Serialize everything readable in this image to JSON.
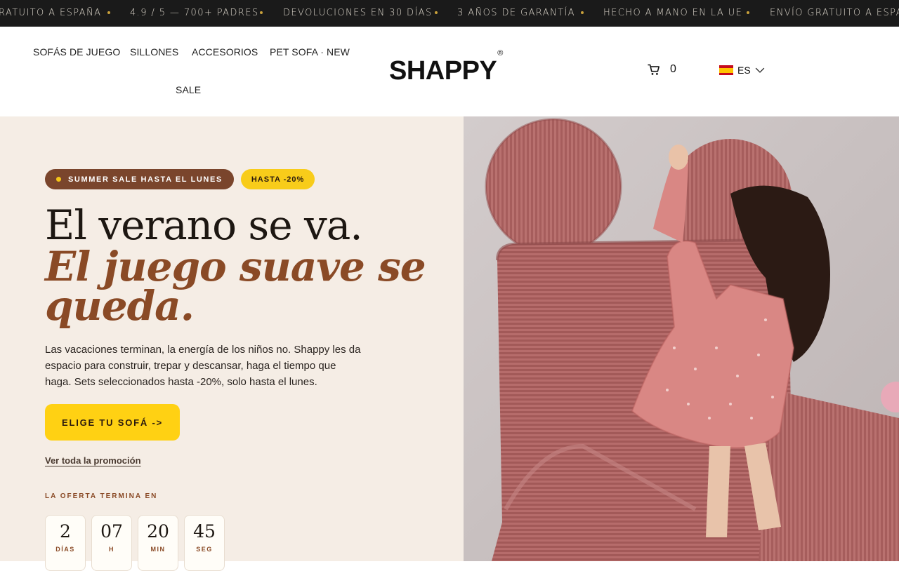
{
  "announcement": {
    "items": [
      "RATUITO A ESPAÑA",
      "4.9 / 5 — 700+ PADRES",
      "DEVOLUCIONES EN 30 DÍAS",
      "3 AÑOS DE GARANTÍA",
      "HECHO A MANO EN LA UE",
      "ENVÍO GRATUITO A ESPAÑA"
    ]
  },
  "nav": {
    "items": [
      "SOFÁS DE JUEGO",
      "SILLONES",
      "ACCESORIOS",
      "PET SOFA · NEW",
      "SALE"
    ]
  },
  "logo": {
    "text": "SHAPPY",
    "mark": "®"
  },
  "cart": {
    "icon": "cart-icon",
    "count": "0"
  },
  "language": {
    "code": "ES",
    "icon": "chevron-down-icon",
    "flag_colors": [
      "#c60b1e",
      "#ffc400",
      "#c60b1e"
    ]
  },
  "hero": {
    "badge_sale": "SUMMER SALE HASTA EL LUNES",
    "badge_discount": "HASTA -20%",
    "headline_line1": "El verano se va.",
    "headline_line2": "El juego suave se",
    "headline_line3": "queda.",
    "description": "Las vacaciones terminan, la energía de los niños no. Shappy les da espacio para construir, trepar y descansar, haga el tiempo que haga. Sets seleccionados hasta -20%, solo hasta el lunes.",
    "cta_label": "ELIGE TU SOFÁ ->",
    "promo_link": "Ver toda la promoción",
    "offer_label": "LA OFERTA TERMINA EN",
    "countdown": [
      {
        "value": "2",
        "unit": "DÍAS"
      },
      {
        "value": "07",
        "unit": "H"
      },
      {
        "value": "20",
        "unit": "MIN"
      },
      {
        "value": "45",
        "unit": "SEG"
      }
    ]
  },
  "colors": {
    "accent_yellow": "#ffd113",
    "brown": "#7a452c",
    "hero_bg": "#f5ede5",
    "topbar_bg": "#1a1a1a"
  }
}
